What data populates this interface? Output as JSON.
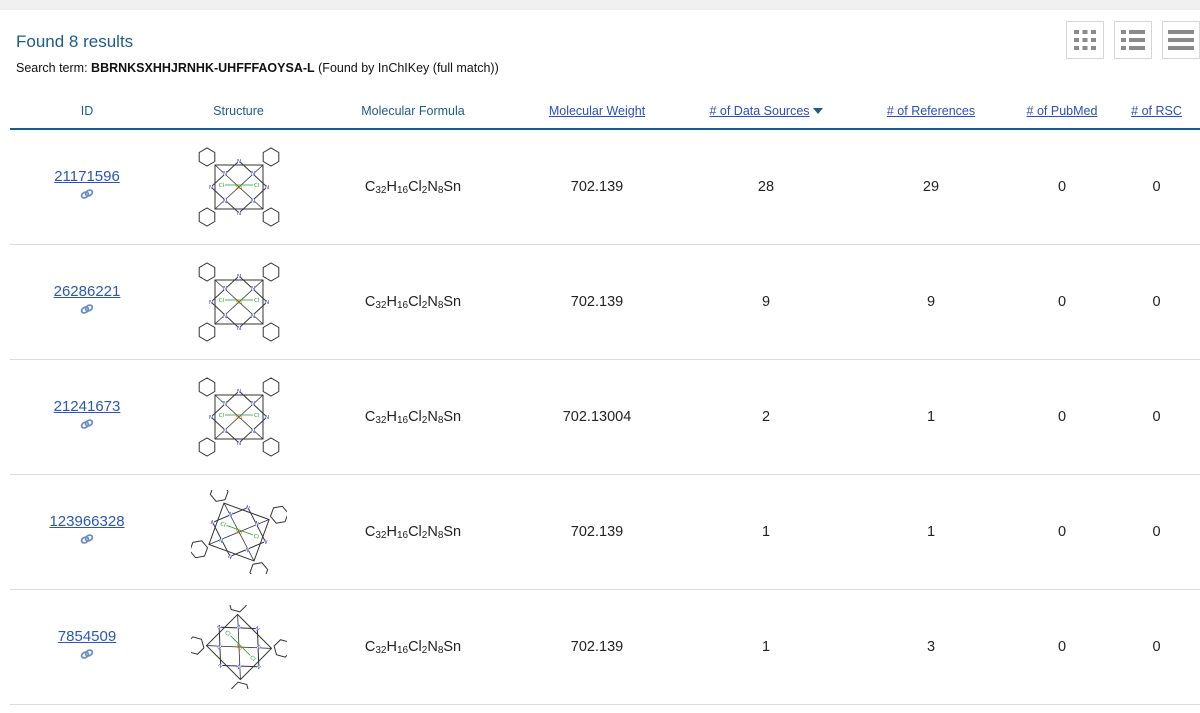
{
  "header": {
    "found_text": "Found 8 results",
    "search_label": "Search term:",
    "search_term": "BBRNKSXHHJRNHK-UHFFFAOYSA-L",
    "search_note": "(Found by InChIKey (full match))"
  },
  "views": [
    {
      "icon": "grid-view-icon"
    },
    {
      "icon": "list-view-icon"
    },
    {
      "icon": "compact-list-icon"
    }
  ],
  "columns": [
    {
      "label": "ID",
      "link": false
    },
    {
      "label": "Structure",
      "link": false
    },
    {
      "label": "Molecular Formula",
      "link": false
    },
    {
      "label": "Molecular Weight",
      "link": true
    },
    {
      "label": "# of Data Sources",
      "link": true,
      "sorted": true
    },
    {
      "label": "# of References",
      "link": true
    },
    {
      "label": "# of PubMed",
      "link": true
    },
    {
      "label": "# of RSC",
      "link": true
    }
  ],
  "formula": {
    "parts": [
      "C",
      "32",
      "H",
      "16",
      "Cl",
      "2",
      "N",
      "8",
      "Sn"
    ]
  },
  "rows": [
    {
      "id": "21171596",
      "weight": "702.139",
      "data_sources": "28",
      "references": "29",
      "pubmed": "0",
      "rsc": "0"
    },
    {
      "id": "26286221",
      "weight": "702.139",
      "data_sources": "9",
      "references": "9",
      "pubmed": "0",
      "rsc": "0"
    },
    {
      "id": "21241673",
      "weight": "702.13004",
      "data_sources": "2",
      "references": "1",
      "pubmed": "0",
      "rsc": "0"
    },
    {
      "id": "123966328",
      "weight": "702.139",
      "data_sources": "1",
      "references": "1",
      "pubmed": "0",
      "rsc": "0"
    },
    {
      "id": "7854509",
      "weight": "702.139",
      "data_sources": "1",
      "references": "3",
      "pubmed": "0",
      "rsc": "0"
    }
  ],
  "icons": {
    "row_link": "chain-link-icon",
    "structure": "molecule-structure-icon"
  },
  "colors": {
    "accent": "#1d5c8a",
    "link": "#2a56b8",
    "nitrogen": "#2b35c9",
    "chlorine": "#1f9a1f",
    "tin": "#c07a00"
  }
}
